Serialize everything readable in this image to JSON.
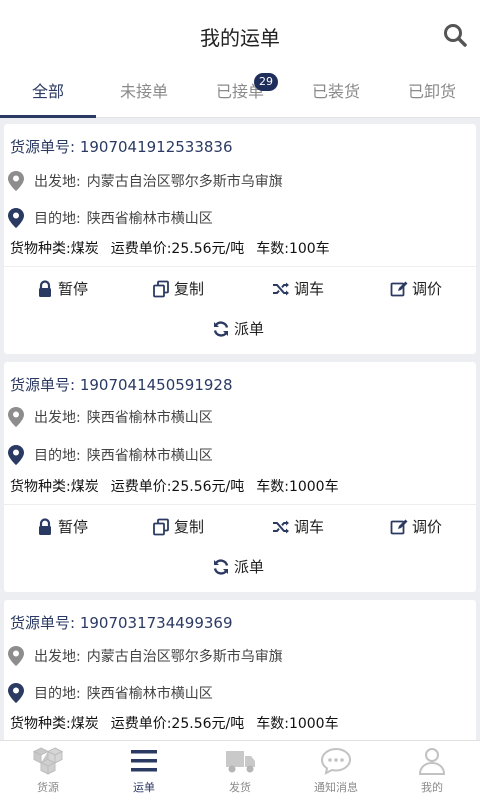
{
  "header": {
    "title": "我的运单"
  },
  "tabs": [
    {
      "label": "全部",
      "active": true
    },
    {
      "label": "未接单"
    },
    {
      "label": "已接单",
      "badge": "29"
    },
    {
      "label": "已装货"
    },
    {
      "label": "已卸货"
    }
  ],
  "orders": [
    {
      "number": "货源单号: 1907041912533836",
      "origin_label": "出发地:",
      "origin": "内蒙古自治区鄂尔多斯市乌审旗",
      "dest_label": "目的地:",
      "dest": "陕西省榆林市横山区",
      "goods": "货物种类:煤炭",
      "price": "运费单价:25.56元/吨",
      "count": "车数:100车"
    },
    {
      "number": "货源单号: 1907041450591928",
      "origin_label": "出发地:",
      "origin": "陕西省榆林市横山区",
      "dest_label": "目的地:",
      "dest": "陕西省榆林市横山区",
      "goods": "货物种类:煤炭",
      "price": "运费单价:25.56元/吨",
      "count": "车数:1000车"
    },
    {
      "number": "货源单号: 1907031734499369",
      "origin_label": "出发地:",
      "origin": "内蒙古自治区鄂尔多斯市乌审旗",
      "dest_label": "目的地:",
      "dest": "陕西省榆林市横山区",
      "goods": "货物种类:煤炭",
      "price": "运费单价:25.56元/吨",
      "count": "车数:1000车"
    }
  ],
  "actions": {
    "pause": "暂停",
    "copy": "复制",
    "dispatch_car": "调车",
    "adjust_price": "调价",
    "assign": "派单"
  },
  "tabbar": [
    {
      "label": "货源",
      "icon": "cubes-icon"
    },
    {
      "label": "运单",
      "icon": "menu-icon",
      "active": true
    },
    {
      "label": "发货",
      "icon": "truck-icon"
    },
    {
      "label": "通知消息",
      "icon": "chat-icon"
    },
    {
      "label": "我的",
      "icon": "user-icon"
    }
  ],
  "colors": {
    "primary": "#2b3a63",
    "muted": "#8a8a8a",
    "background": "#eceef1"
  }
}
